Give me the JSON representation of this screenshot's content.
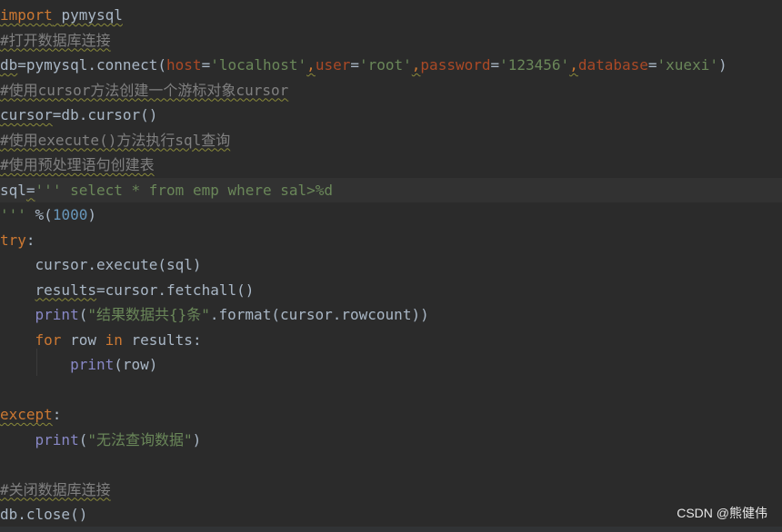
{
  "code": {
    "l1": {
      "a": "import",
      "b": " ",
      "c": "pymysql"
    },
    "l2": {
      "a": "#打开数据库连接"
    },
    "l3": {
      "a": "db",
      "b": "=pymysql.connect(",
      "c": "host",
      "d": "=",
      "e": "'localhost'",
      "f": ",",
      "g": "user",
      "h": "=",
      "i": "'root'",
      "j": ",",
      "k": "password",
      "l": "=",
      "m": "'123456'",
      "n": ",",
      "o": "database",
      "p": "=",
      "q": "'xuexi'",
      "r": ")"
    },
    "l4": {
      "a": "#使用cursor方法创建一个游标对象cursor"
    },
    "l5": {
      "a": "cursor",
      "b": "=db.cursor()"
    },
    "l6": {
      "a": "#使用execute()方法执行sql查询"
    },
    "l7": {
      "a": "#使用预处理语句创建表"
    },
    "l8": {
      "a": "sql",
      "b": "=",
      "c": "''' select * from emp where sal>%d"
    },
    "l9": {
      "a": "'''",
      "b": " %(",
      "c": "1000",
      "d": ")"
    },
    "l10": {
      "a": "try",
      "b": ":"
    },
    "l11": {
      "a": "    cursor.execute(sql)"
    },
    "l12": {
      "a": "    ",
      "b": "results",
      "c": "=cursor.fetchall()"
    },
    "l13": {
      "a": "    ",
      "b": "print",
      "c": "(",
      "d": "\"结果数据共{}条\"",
      "e": ".format(cursor.rowcount))"
    },
    "l14": {
      "a": "    ",
      "b": "for",
      "c": " row ",
      "d": "in",
      "e": " results:"
    },
    "l15": {
      "a": "        ",
      "b": "print",
      "c": "(row)"
    },
    "l16": {
      "a": ""
    },
    "l17": {
      "a": "except",
      "b": ":"
    },
    "l18": {
      "a": "    ",
      "b": "print",
      "c": "(",
      "d": "\"无法查询数据\"",
      "e": ")"
    },
    "l19": {
      "a": ""
    },
    "l20": {
      "a": "#关闭数据库连接"
    },
    "l21": {
      "a": "db.close()"
    }
  },
  "watermark": "CSDN @熊健伟",
  "colors": {
    "background": "#2b2b2b",
    "keyword": "#cc7832",
    "comment": "#808080",
    "string": "#6a8759",
    "number": "#6897bb",
    "builtin": "#8888c6",
    "parameter": "#aa4926",
    "text": "#a9b7c6"
  }
}
